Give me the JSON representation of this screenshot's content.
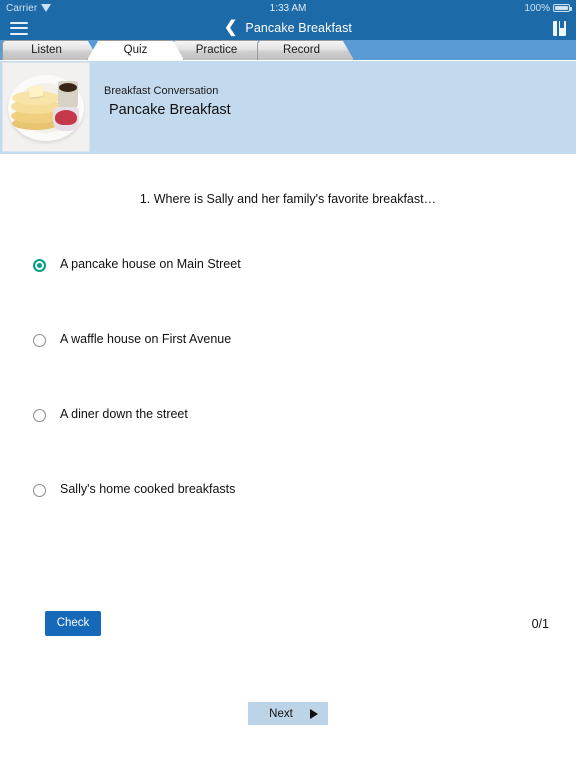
{
  "status_bar": {
    "carrier": "Carrier",
    "wifi_icon": "wifi-icon",
    "time": "1:33 AM",
    "battery_percent": "100%",
    "battery_icon": "battery-icon"
  },
  "nav_bar": {
    "menu_icon": "hamburger-icon",
    "back_icon": "chevron-left-icon",
    "title": "Pancake Breakfast",
    "book_icon": "book-icon",
    "background_color": "#1c6aa8"
  },
  "tabs": [
    {
      "label": "Listen",
      "active": false
    },
    {
      "label": "Quiz",
      "active": true
    },
    {
      "label": "Practice",
      "active": false
    },
    {
      "label": "Record",
      "active": false
    }
  ],
  "lesson": {
    "thumbnail_alt": "pancake-plate-photo",
    "category": "Breakfast Conversation",
    "title": "Pancake Breakfast",
    "background_color": "#c3d9ee"
  },
  "quiz": {
    "question": "1. Where is Sally and her family's favorite breakfast…",
    "options": [
      {
        "label": "A pancake house on Main Street",
        "selected": true
      },
      {
        "label": "A waffle house on First Avenue",
        "selected": false
      },
      {
        "label": "A diner down the street",
        "selected": false
      },
      {
        "label": "Sally's home cooked breakfasts",
        "selected": false
      }
    ],
    "selected_color": "#00a085",
    "check_label": "Check",
    "check_color": "#1668b8",
    "score": "0/1",
    "next_label": "Next",
    "next_arrow_icon": "play-triangle-icon",
    "next_color": "#bcd4e8"
  }
}
